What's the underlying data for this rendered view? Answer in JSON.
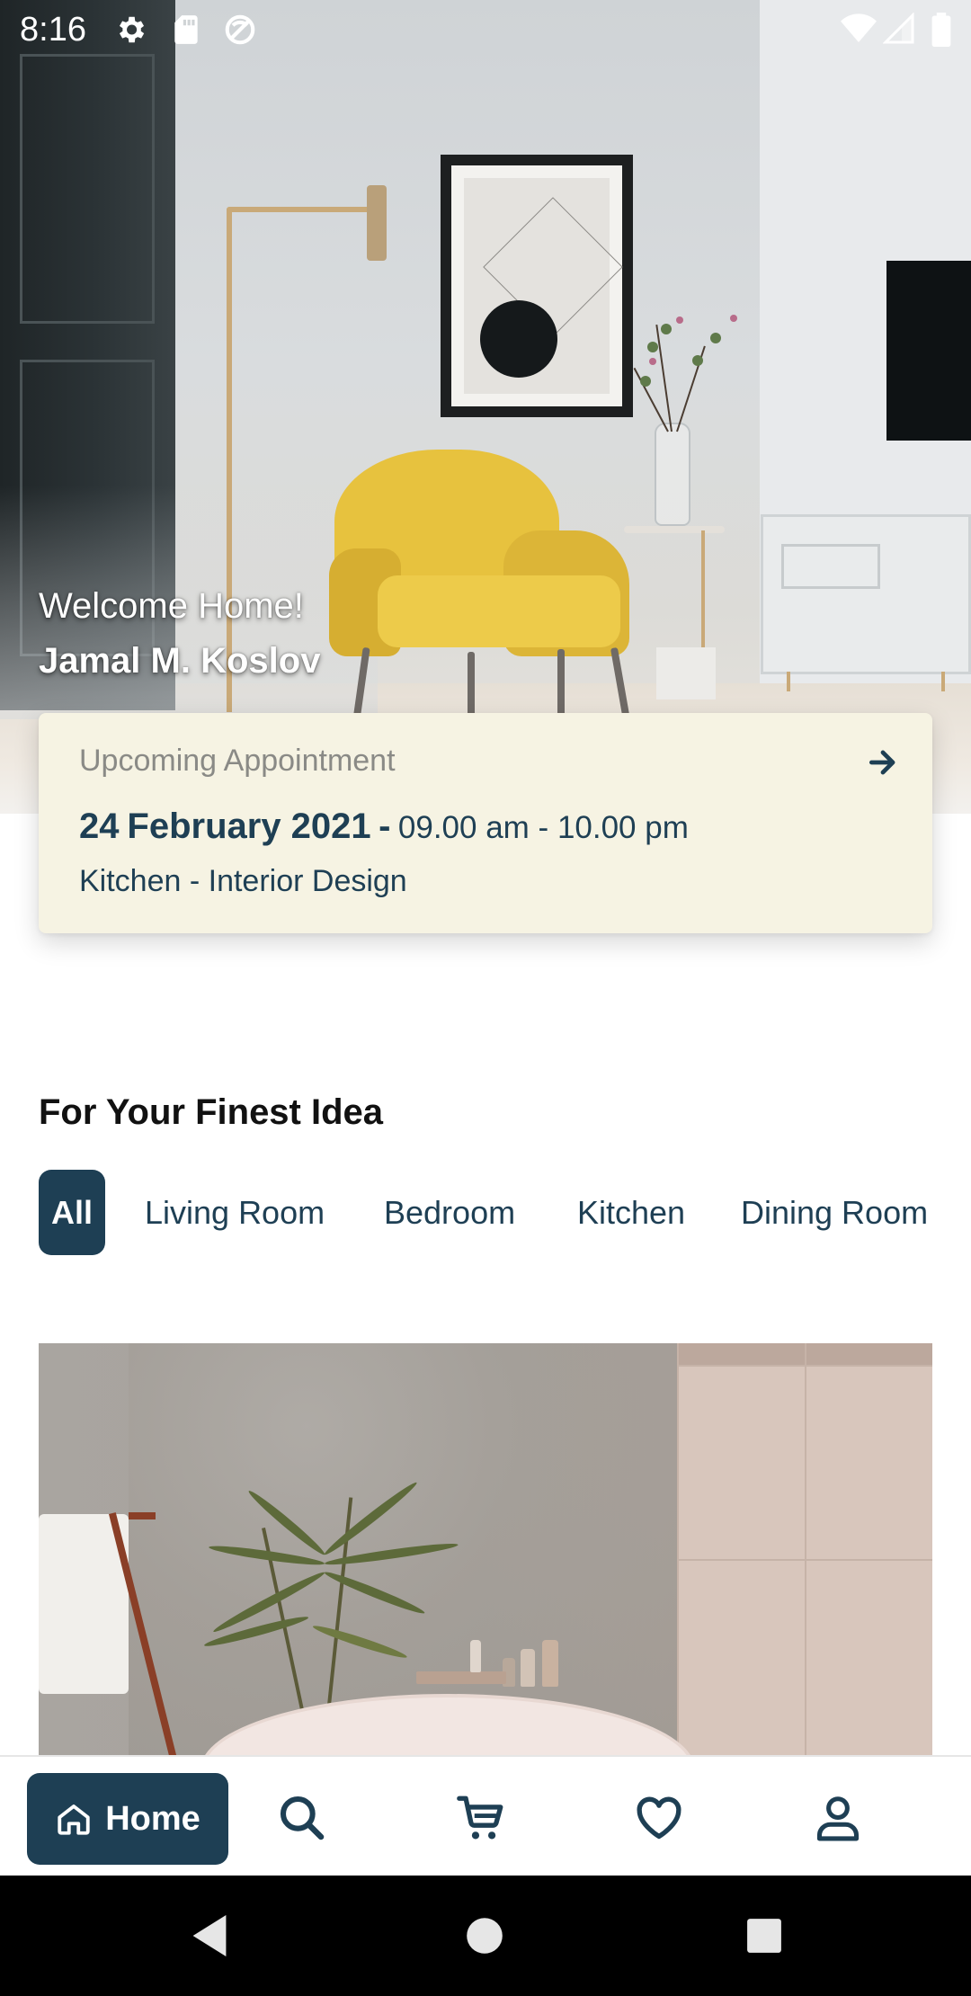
{
  "status_bar": {
    "time": "8:16",
    "left_icons": [
      "gear-icon",
      "sd-card-icon",
      "no-disturb-icon"
    ],
    "right_icons": [
      "wifi-icon",
      "signal-icon",
      "battery-icon"
    ]
  },
  "hero": {
    "welcome": "Welcome Home!",
    "user_name": "Jamal M. Koslov"
  },
  "appointment": {
    "label": "Upcoming Appointment",
    "day": "24",
    "month_year": "February 2021",
    "separator": "-",
    "hours": "09.00 am - 10.00 pm",
    "service": "Kitchen - Interior Design",
    "arrow_icon": "arrow-right-icon"
  },
  "section": {
    "title": "For Your Finest Idea"
  },
  "categories": [
    {
      "label": "All",
      "active": true
    },
    {
      "label": "Living Room",
      "active": false
    },
    {
      "label": "Bedroom",
      "active": false
    },
    {
      "label": "Kitchen",
      "active": false
    },
    {
      "label": "Dining Room",
      "active": false
    }
  ],
  "bottom_nav": {
    "home_label": "Home",
    "items": [
      "home-icon",
      "search-icon",
      "cart-icon",
      "heart-icon",
      "profile-icon"
    ]
  },
  "colors": {
    "primary": "#1e3f54",
    "card_bg": "#f6f3e3",
    "muted_text": "#8a8a86"
  }
}
